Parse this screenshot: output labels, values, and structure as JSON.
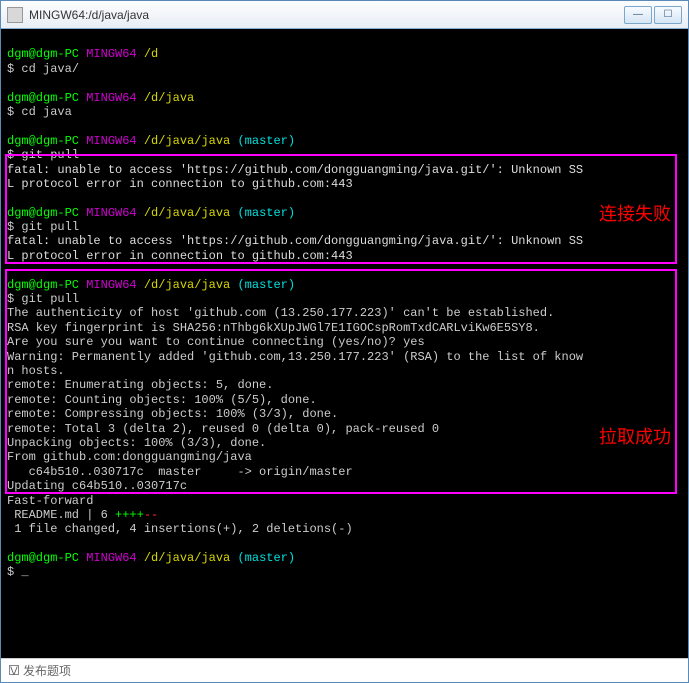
{
  "titlebar": {
    "title": "MINGW64:/d/java/java"
  },
  "prompt": {
    "user": "dgm@dgm-PC",
    "shell": "MINGW64",
    "path1": "/d",
    "path2": "/d/java",
    "path3": "/d/java/java",
    "branch": "(master)",
    "dollar": "$"
  },
  "cmds": {
    "cd_java_slash": "cd java/",
    "cd_java": "cd java",
    "git_pull": "git pull"
  },
  "err": {
    "line1": "fatal: unable to access 'https://github.com/dongguangming/java.git/': Unknown SS",
    "line2": "L protocol error in connection to github.com:443"
  },
  "pull": {
    "l1": "The authenticity of host 'github.com (13.250.177.223)' can't be established.",
    "l2": "RSA key fingerprint is SHA256:nThbg6kXUpJWGl7E1IGOCspRomTxdCARLviKw6E5SY8.",
    "l3": "Are you sure you want to continue connecting (yes/no)? yes",
    "l4": "Warning: Permanently added 'github.com,13.250.177.223' (RSA) to the list of know",
    "l5": "n hosts.",
    "l6": "remote: Enumerating objects: 5, done.",
    "l7": "remote: Counting objects: 100% (5/5), done.",
    "l8": "remote: Compressing objects: 100% (3/3), done.",
    "l9": "remote: Total 3 (delta 2), reused 0 (delta 0), pack-reused 0",
    "l10": "Unpacking objects: 100% (3/3), done.",
    "l11": "From github.com:dongguangming/java",
    "l12": "   c64b510..030717c  master     -> origin/master",
    "l13": "Updating c64b510..030717c",
    "l14": "Fast-forward",
    "l15a": " README.md | 6 ",
    "l15plus": "++++",
    "l15minus": "--",
    "l16": " 1 file changed, 4 insertions(+), 2 deletions(-)"
  },
  "anno": {
    "fail": "连接失败",
    "success": "拉取成功"
  },
  "footer": {
    "text": "发布题项"
  },
  "cursor": "_"
}
